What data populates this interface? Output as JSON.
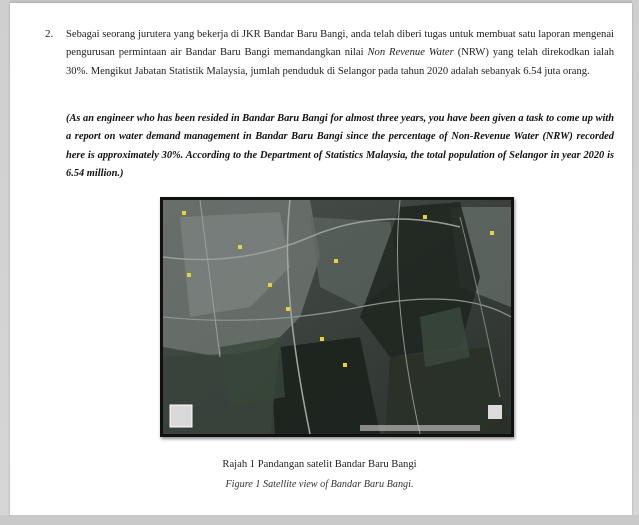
{
  "question": {
    "number": "2.",
    "malay_part1": "Sebagai seorang jurutera yang bekerja di JKR Bandar Baru Bangi, anda telah diberi tugas untuk membuat satu laporan mengenai pengurusan permintaan air Bandar Baru Bangi memandangkan nilai ",
    "malay_italic": "Non Revenue Water",
    "malay_part2": " (NRW) yang telah direkodkan ialah 30%. Mengikut Jabatan Statistik Malaysia, jumlah penduduk di Selangor pada tahun 2020 adalah sebanyak 6.54 juta orang.",
    "english": "(As an engineer who has been resided in Bandar Baru Bangi for almost three years, you have been given a task to come up with a report on water demand management in Bandar Baru Bangi since the percentage of Non-Revenue Water (NRW) recorded here is approximately 30%. According to the Department of Statistics Malaysia, the total population of Selangor in year 2020 is 6.54 million.)"
  },
  "figure": {
    "caption_ms": "Rajah 1  Pandangan satelit Bandar Baru Bangi",
    "caption_en": "Figure 1  Satellite view of Bandar Baru Bangi."
  },
  "colors": {
    "page": "#ffffff",
    "text": "#222222",
    "map_dark": "#1e241f",
    "map_green": "#37463a",
    "map_urban": "#6f7672"
  }
}
